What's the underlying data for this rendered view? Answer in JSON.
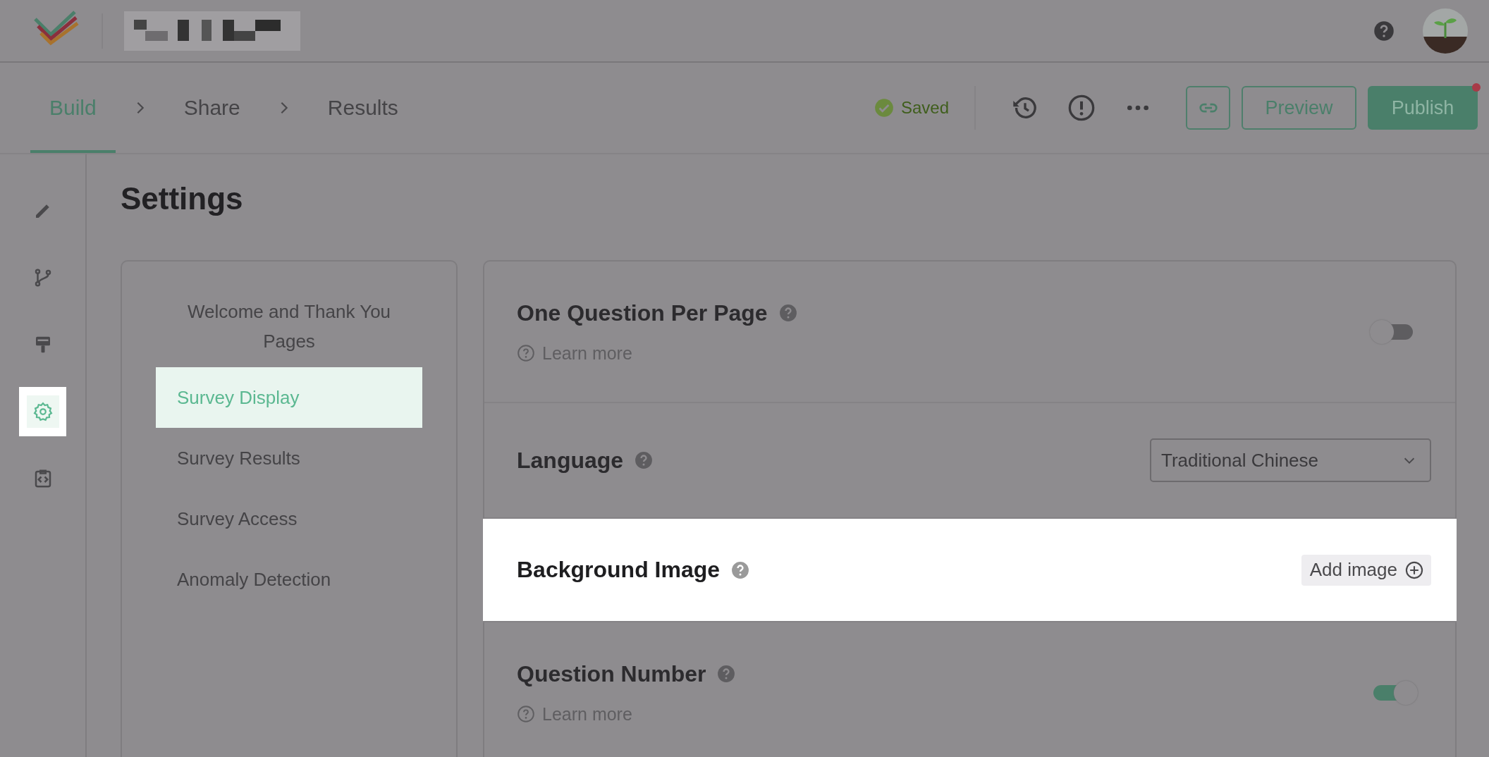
{
  "steps": [
    {
      "label": "Build",
      "selected": true
    },
    {
      "label": "Share",
      "selected": false
    },
    {
      "label": "Results",
      "selected": false
    }
  ],
  "save_status": "Saved",
  "actions": {
    "preview": "Preview",
    "publish": "Publish",
    "publish_notification": true
  },
  "sidebar": {
    "items": [
      {
        "kind": "edit",
        "selected": false,
        "spotlight": false
      },
      {
        "kind": "logic",
        "selected": false,
        "spotlight": false
      },
      {
        "kind": "theme",
        "selected": false,
        "spotlight": false
      },
      {
        "kind": "settings",
        "selected": true,
        "spotlight": true
      },
      {
        "kind": "embed",
        "selected": false,
        "spotlight": false
      }
    ]
  },
  "page_title": "Settings",
  "settings_menu": [
    {
      "label": "Welcome and Thank You Pages",
      "selected": false,
      "spotlight": false
    },
    {
      "label": "Survey Display",
      "selected": true,
      "spotlight": true
    },
    {
      "label": "Survey Results",
      "selected": false,
      "spotlight": false
    },
    {
      "label": "Survey Access",
      "selected": false,
      "spotlight": false
    },
    {
      "label": "Anomaly Detection",
      "selected": false,
      "spotlight": false
    }
  ],
  "settings": [
    {
      "kind": "toggle",
      "title": "One Question Per Page",
      "learn_more": "Learn more",
      "on": false,
      "spotlight": false
    },
    {
      "kind": "select",
      "title": "Language",
      "value": "Traditional Chinese",
      "spotlight": false
    },
    {
      "kind": "button",
      "title": "Background Image",
      "button": "Add image",
      "spotlight": true
    },
    {
      "kind": "toggle",
      "title": "Question Number",
      "learn_more": "Learn more",
      "on": true,
      "spotlight": false
    }
  ]
}
